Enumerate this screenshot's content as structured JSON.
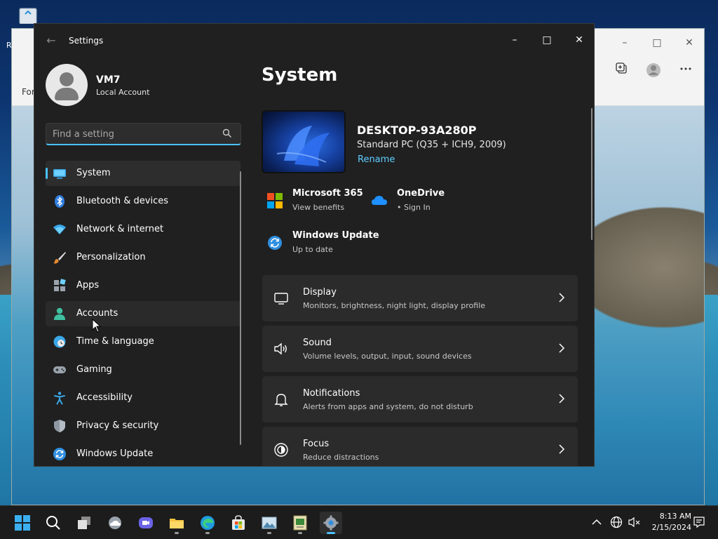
{
  "window": {
    "title": "Settings",
    "back_glyph": "←",
    "minimize_glyph": "–",
    "maximize_glyph": "□",
    "close_glyph": "✕"
  },
  "profile": {
    "name": "VM7",
    "account_type": "Local Account"
  },
  "search": {
    "placeholder": "Find a setting"
  },
  "nav": {
    "items": [
      {
        "label": "System",
        "icon": "system-icon",
        "selected": true
      },
      {
        "label": "Bluetooth & devices",
        "icon": "bluetooth-icon"
      },
      {
        "label": "Network & internet",
        "icon": "wifi-icon"
      },
      {
        "label": "Personalization",
        "icon": "brush-icon"
      },
      {
        "label": "Apps",
        "icon": "apps-icon"
      },
      {
        "label": "Accounts",
        "icon": "account-icon"
      },
      {
        "label": "Time & language",
        "icon": "clock-globe-icon"
      },
      {
        "label": "Gaming",
        "icon": "controller-icon"
      },
      {
        "label": "Accessibility",
        "icon": "accessibility-icon"
      },
      {
        "label": "Privacy & security",
        "icon": "shield-icon"
      },
      {
        "label": "Windows Update",
        "icon": "update-icon"
      }
    ]
  },
  "main": {
    "title": "System",
    "device": {
      "name": "DESKTOP-93A280P",
      "model": "Standard PC (Q35 + ICH9, 2009)",
      "rename_label": "Rename"
    },
    "quick": {
      "m365": {
        "title": "Microsoft 365",
        "subtitle": "View benefits"
      },
      "onedrive": {
        "title": "OneDrive",
        "subtitle": "• Sign In"
      },
      "update": {
        "title": "Windows Update",
        "subtitle": "Up to date"
      }
    },
    "cards": [
      {
        "title": "Display",
        "subtitle": "Monitors, brightness, night light, display profile",
        "icon": "monitor-icon"
      },
      {
        "title": "Sound",
        "subtitle": "Volume levels, output, input, sound devices",
        "icon": "speaker-icon"
      },
      {
        "title": "Notifications",
        "subtitle": "Alerts from apps and system, do not disturb",
        "icon": "bell-icon"
      },
      {
        "title": "Focus",
        "subtitle": "Reduce distractions",
        "icon": "focus-icon"
      }
    ]
  },
  "background_window": {
    "left_text": "For",
    "recycle_label": "R"
  },
  "taskbar": {
    "clock": {
      "time": "8:13 AM",
      "date": "2/15/2024"
    }
  },
  "colors": {
    "accent": "#4cc2ff",
    "link": "#60cdff",
    "window_bg": "#202020",
    "card_bg": "#2b2b2b"
  }
}
